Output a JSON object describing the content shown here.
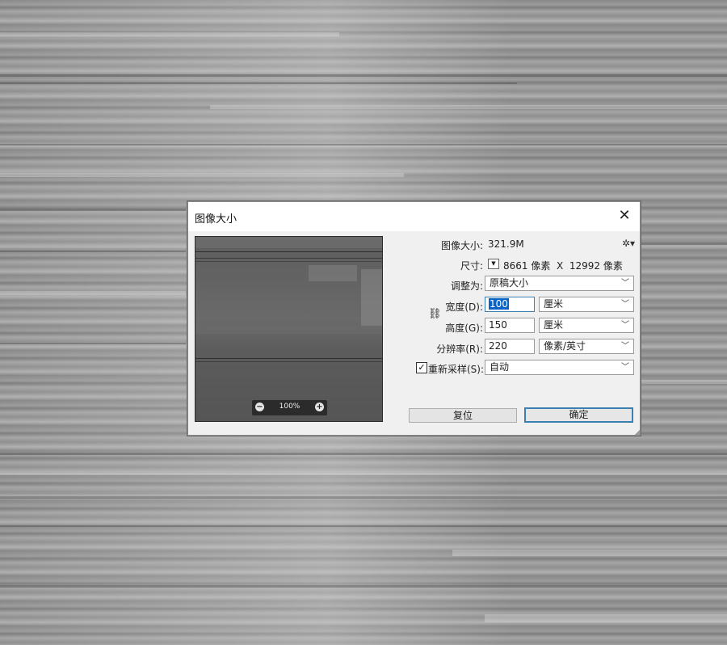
{
  "dialog": {
    "title": "图像大小",
    "close_icon": "close-icon",
    "image_size_label": "图像大小:",
    "image_size_value": "321.9M",
    "settings_icon": "gear-icon",
    "dimensions_label": "尺寸:",
    "dimensions_value": "8661 像素  X  12992 像素",
    "fit_to_label": "调整为:",
    "fit_to_value": "原稿大小",
    "width_label": "宽度(D):",
    "width_value": "100",
    "width_unit": "厘米",
    "height_label": "高度(G):",
    "height_value": "150",
    "height_unit": "厘米",
    "resolution_label": "分辨率(R):",
    "resolution_value": "220",
    "resolution_unit": "像素/英寸",
    "resample_label": "重新采样(S):",
    "resample_checked": true,
    "resample_value": "自动",
    "reset_button": "复位",
    "ok_button": "确定",
    "accent_color": "#3c7fb1"
  },
  "preview": {
    "zoom": "100%",
    "zoom_out_icon": "zoom-out-icon",
    "zoom_in_icon": "zoom-in-icon"
  }
}
